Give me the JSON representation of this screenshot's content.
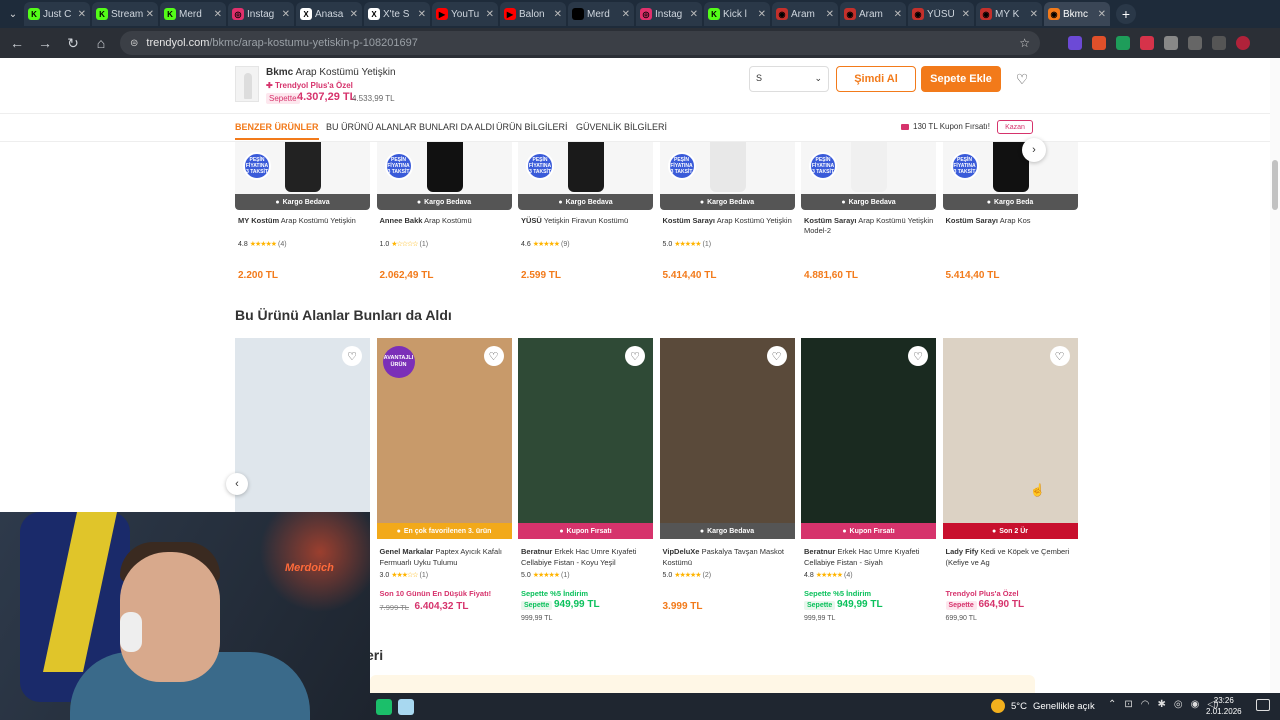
{
  "browser": {
    "tabs": [
      {
        "label": "Just C",
        "fav": "K",
        "color": "#53fc18"
      },
      {
        "label": "Stream",
        "fav": "K",
        "color": "#53fc18"
      },
      {
        "label": "Merd",
        "fav": "K",
        "color": "#53fc18"
      },
      {
        "label": "Instag",
        "fav": "◎",
        "color": "#e1306c"
      },
      {
        "label": "Anasa",
        "fav": "X",
        "color": "#ffffff"
      },
      {
        "label": "X'te S",
        "fav": "X",
        "color": "#ffffff"
      },
      {
        "label": "YouTu",
        "fav": "▶",
        "color": "#ff0000"
      },
      {
        "label": "Balon",
        "fav": "▶",
        "color": "#ff0000"
      },
      {
        "label": "Merd",
        "fav": "♪",
        "color": "#000000"
      },
      {
        "label": "Instag",
        "fav": "◎",
        "color": "#e1306c"
      },
      {
        "label": "Kick l",
        "fav": "K",
        "color": "#53fc18"
      },
      {
        "label": "Aram",
        "fav": "◉",
        "color": "#c4302b"
      },
      {
        "label": "Aram",
        "fav": "◉",
        "color": "#c4302b"
      },
      {
        "label": "YÜSÜ",
        "fav": "◉",
        "color": "#c4302b"
      },
      {
        "label": "MY K",
        "fav": "◉",
        "color": "#c4302b"
      },
      {
        "label": "Bkmc",
        "fav": "◉",
        "color": "#f27a1a",
        "active": true
      }
    ],
    "url_domain": "trendyol.com",
    "url_path": "/bkmc/arap-kostumu-yetiskin-p-108201697"
  },
  "sticky": {
    "brand": "Bkmc",
    "product": "Arap Kostümü Yetişkin",
    "plus": "Trendyol Plus'a Özel",
    "sepette_label": "Sepette",
    "sepette_price": "4.307,29 TL",
    "old_price": "4.533,99 TL",
    "size_value": "S",
    "buy_now": "Şimdi Al",
    "add_to_cart": "Sepete Ekle"
  },
  "subnav": {
    "items": [
      "BENZER ÜRÜNLER",
      "BU ÜRÜNÜ ALANLAR BUNLARI DA ALDI",
      "ÜRÜN BİLGİLERİ",
      "GÜVENLİK BİLGİLERİ"
    ],
    "coupon": "130 TL Kupon Fırsatı!",
    "kazan": "Kazan"
  },
  "similar": [
    {
      "brand": "MY Kostüm",
      "name": "Arap Kostümü Yetişkin",
      "rating": "4.8",
      "stars": 5,
      "count": "(4)",
      "price": "2.200 TL",
      "kargo": "Kargo Bedava",
      "badge": "PEŞİN FİYATINA 3 TAKSİT",
      "color": "#222"
    },
    {
      "brand": "Annee Bakk",
      "name": "Arap Kostümü",
      "rating": "1.0",
      "stars": 1,
      "count": "(1)",
      "price": "2.062,49 TL",
      "kargo": "Kargo Bedava",
      "badge": "PEŞİN FİYATINA 3 TAKSİT",
      "color": "#111"
    },
    {
      "brand": "YÜSÜ",
      "name": "Yetişkin Firavun Kostümü",
      "rating": "4.6",
      "stars": 5,
      "count": "(9)",
      "price": "2.599 TL",
      "kargo": "Kargo Bedava",
      "badge": "PEŞİN FİYATINA 3 TAKSİT",
      "color": "#1a1a1a"
    },
    {
      "brand": "Kostüm Sarayı",
      "name": "Arap Kostümü Yetişkin",
      "rating": "5.0",
      "stars": 5,
      "count": "(1)",
      "price": "5.414,40 TL",
      "kargo": "Kargo Bedava",
      "badge": "PEŞİN FİYATINA 3 TAKSİT",
      "color": "#e8e8e8"
    },
    {
      "brand": "Kostüm Sarayı",
      "name": "Arap Kostümü Yetişkin Model-2",
      "rating": "",
      "stars": 0,
      "count": "",
      "price": "4.881,60 TL",
      "kargo": "Kargo Bedava",
      "badge": "PEŞİN FİYATINA 3 TAKSİT",
      "color": "#f0f0f0"
    },
    {
      "brand": "Kostüm Sarayı",
      "name": "Arap Kos",
      "rating": "",
      "stars": 0,
      "count": "",
      "price": "5.414,40 TL",
      "kargo": "Kargo Beda",
      "badge": "PEŞİN FİYATINA 3 TAKSİT",
      "color": "#111"
    }
  ],
  "section_title": "Bu Ürünü Alanlar Bunları da Aldı",
  "bought": [
    {
      "brand": "",
      "name": "",
      "rating": "",
      "count": "",
      "strip": "",
      "strip_color": "#ffffff",
      "promo": "",
      "promo_color": "#333",
      "sepet": "",
      "sprice": "",
      "under": "",
      "mainprice": "",
      "img": "#dfe6ec"
    },
    {
      "brand": "Genel Markalar",
      "name": "Paptex Ayıcık Kafalı Fermuarlı Uyku Tulumu",
      "rating": "3.0",
      "stars": 3,
      "count": "(1)",
      "strip": "En çok favorilenen 3. ürün",
      "strip_color": "#f2a91a",
      "promo": "Son 10 Günün En Düşük Fiyatı!",
      "promo_color": "#d6336c",
      "old": "7.999 TL",
      "mainprice_red": "6.404,32 TL",
      "img": "#c89a6a",
      "avantaj": "AVANTAJLI ÜRÜN"
    },
    {
      "brand": "Beratnur",
      "name": "Erkek Hac Umre Kıyafeti Cellabiye Fistan - Koyu Yeşil",
      "rating": "5.0",
      "stars": 5,
      "count": "(1)",
      "strip": "Kupon Fırsatı",
      "strip_color": "#d6336c",
      "promo": "Sepette %5 İndirim",
      "promo_color": "#0bc15c",
      "sepet": "Sepette",
      "sprice": "949,99 TL",
      "under": "999,99 TL",
      "img": "#2f4a36"
    },
    {
      "brand": "VipDeluXe",
      "name": "Paskalya Tavşan Maskot Kostümü",
      "rating": "5.0",
      "stars": 5,
      "count": "(2)",
      "strip": "Kargo Bedava",
      "strip_color": "#555555",
      "mainprice": "3.999 TL",
      "img": "#5a4a3a"
    },
    {
      "brand": "Beratnur",
      "name": "Erkek Hac Umre Kıyafeti Cellabiye Fistan - Siyah",
      "rating": "4.8",
      "stars": 5,
      "count": "(4)",
      "strip": "Kupon Fırsatı",
      "strip_color": "#d6336c",
      "promo": "Sepette %5 İndirim",
      "promo_color": "#0bc15c",
      "sepet": "Sepette",
      "sprice": "949,99 TL",
      "under": "999,99 TL",
      "img": "#1a2a20"
    },
    {
      "brand": "Lady Fify",
      "name": "Kedi ve Köpek ve Çemberi (Kefiye ve Ag",
      "rating": "",
      "stars": 0,
      "count": "",
      "strip": "Son 2 Ür",
      "strip_color": "#c8102e",
      "promo": "Trendyol Plus'a Özel",
      "promo_color": "#d6336c",
      "sepet": "Sepette",
      "sprice": "664,90 TL",
      "under": "699,90 TL",
      "img": "#dcd2c4",
      "pink": true
    }
  ],
  "partial_title": "eri",
  "taskbar": {
    "weather_temp": "5°C",
    "weather_text": "Genellikle açık",
    "time": "23:26",
    "date": "2.01.2026"
  },
  "webcam": {
    "sign": "Merdoich"
  }
}
